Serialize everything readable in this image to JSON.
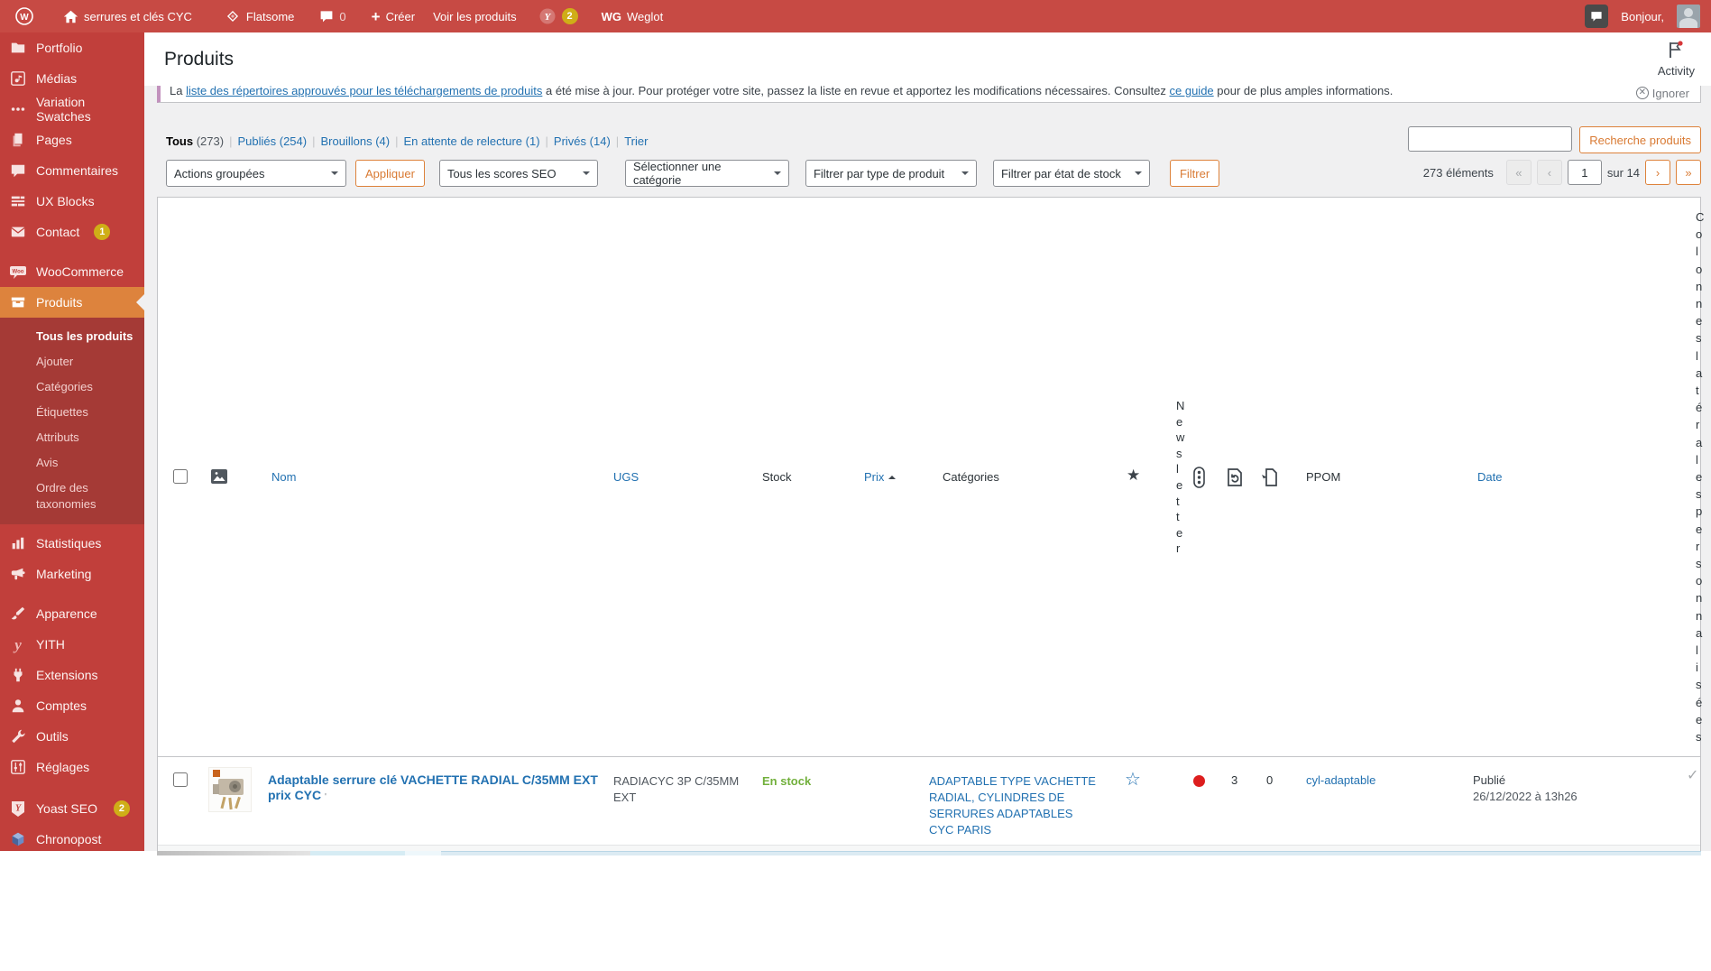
{
  "colors": {
    "topbar": "#c74a44",
    "sidebar": "#c13f3b",
    "submenu": "#a53a36",
    "current_item": "#dd833d",
    "link_blue": "#2271b1",
    "button_orange": "#dd823b",
    "badge_yellow": "#cfae17",
    "stock_green": "#72b03c",
    "dot_red": "#dd1e1e",
    "notice_border": "#c292bd"
  },
  "admin_bar": {
    "site_name": "serrures et clés CYC",
    "theme_name": "Flatsome",
    "comments_count": "0",
    "new_label": "Créer",
    "view_products_label": "Voir les produits",
    "yoast_badge": "2",
    "weglot_initials": "WG",
    "weglot_label": "Weglot",
    "greeting": "Bonjour,"
  },
  "sidebar": {
    "items": [
      {
        "label": "Portfolio"
      },
      {
        "label": "Médias"
      },
      {
        "label": "Variation Swatches"
      },
      {
        "label": "Pages"
      },
      {
        "label": "Commentaires"
      },
      {
        "label": "UX Blocks"
      },
      {
        "label": "Contact",
        "badge": "1"
      },
      {
        "label": "WooCommerce"
      },
      {
        "label": "Produits",
        "current": true
      },
      {
        "label": "Statistiques"
      },
      {
        "label": "Marketing"
      },
      {
        "label": "Apparence"
      },
      {
        "label": "YITH"
      },
      {
        "label": "Extensions"
      },
      {
        "label": "Comptes"
      },
      {
        "label": "Outils"
      },
      {
        "label": "Réglages"
      },
      {
        "label": "Yoast SEO",
        "badge": "2"
      },
      {
        "label": "Chronopost"
      }
    ],
    "produits_submenu": [
      {
        "label": "Tous les produits",
        "current": true
      },
      {
        "label": "Ajouter"
      },
      {
        "label": "Catégories"
      },
      {
        "label": "Étiquettes"
      },
      {
        "label": "Attributs"
      },
      {
        "label": "Avis"
      },
      {
        "label": "Ordre des taxonomies"
      }
    ]
  },
  "header": {
    "title": "Produits",
    "activity_label": "Activity"
  },
  "notice": {
    "text_prefix": "La ",
    "link1": "liste des répertoires approuvés pour les téléchargements de produits",
    "text_mid": " a été mise à jour. Pour protéger votre site, passez la liste en revue et apportez les modifications nécessaires. Consultez ",
    "link2": "ce guide",
    "text_suffix": " pour de plus amples informations.",
    "dismiss_label": "Ignorer"
  },
  "status_links": [
    {
      "label": "Tous",
      "count": "(273)",
      "current": true
    },
    {
      "label": "Publiés",
      "count": "(254)"
    },
    {
      "label": "Brouillons",
      "count": "(4)"
    },
    {
      "label": "En attente de relecture",
      "count": "(1)"
    },
    {
      "label": "Privés",
      "count": "(14)"
    },
    {
      "label": "Trier",
      "count": ""
    }
  ],
  "filters": {
    "bulk_actions": "Actions groupées",
    "apply_label": "Appliquer",
    "seo_scores": "Tous les scores SEO",
    "category": "Sélectionner une catégorie",
    "product_type": "Filtrer par type de produit",
    "stock_state": "Filtrer par état de stock",
    "filter_label": "Filtrer",
    "search_button": "Recherche produits",
    "search_value": ""
  },
  "pagination": {
    "count": "273 éléments",
    "first": "«",
    "prev": "‹",
    "page": "1",
    "of": "sur 14",
    "next": "›",
    "last": "»"
  },
  "table": {
    "headers": {
      "name": "Nom",
      "sku": "UGS",
      "stock": "Stock",
      "price": "Prix",
      "categories": "Catégories",
      "newsletter": "Newsletter",
      "ppom": "PPOM",
      "date": "Date",
      "side_columns": "Colonnes latérales personnalisées"
    },
    "row": {
      "name": "Adaptable serrure clé VACHETTE RADIAL C/35MM EXT prix CYC",
      "name_mark": "'",
      "sku": "RADIACYC 3P C/35MM EXT",
      "stock": "En stock",
      "price": "",
      "category_1": "ADAPTABLE TYPE VACHETTE RADIAL",
      "category_sep": ", ",
      "category_2": "CYLINDRES DE SERRURES ADAPTABLES CYC PARIS",
      "refresh_value": "3",
      "export_value": "0",
      "ppom": "cyl-adaptable",
      "date_status": "Publié",
      "date_value": "26/12/2022 à 13h26",
      "side_value": "✓"
    }
  }
}
